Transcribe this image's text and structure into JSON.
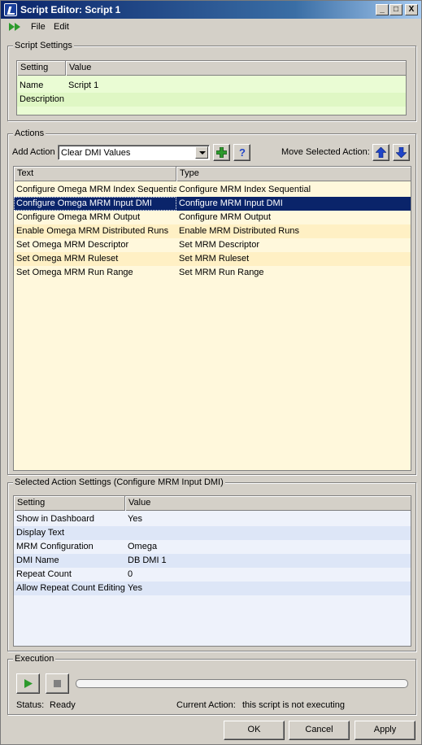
{
  "window": {
    "title": "Script Editor: Script 1",
    "controls": {
      "minimize": "_",
      "maximize": "□",
      "close": "X"
    }
  },
  "menu": {
    "run_icon": "run-forward-icon",
    "items": [
      "File",
      "Edit"
    ]
  },
  "script_settings": {
    "group_label": "Script Settings",
    "columns": [
      "Setting",
      "Value"
    ],
    "rows": [
      {
        "setting": "Name",
        "value": "Script 1"
      },
      {
        "setting": "Description",
        "value": ""
      }
    ]
  },
  "actions": {
    "group_label": "Actions",
    "add_action_label": "Add Action",
    "add_action_value": "Clear DMI Values",
    "add_icon": "add-icon",
    "help_icon": "help-icon",
    "move_label": "Move Selected Action:",
    "move_up_icon": "arrow-up-icon",
    "move_down_icon": "arrow-down-icon",
    "columns": [
      "Text",
      "Type"
    ],
    "rows": [
      {
        "text": "Configure Omega MRM Index Sequential",
        "type": "Configure MRM Index Sequential"
      },
      {
        "text": "Configure Omega MRM Input DMI",
        "type": "Configure MRM Input DMI"
      },
      {
        "text": "Configure Omega MRM Output",
        "type": "Configure MRM Output"
      },
      {
        "text": "Enable Omega MRM Distributed Runs",
        "type": "Enable MRM Distributed Runs"
      },
      {
        "text": "Set Omega MRM Descriptor",
        "type": "Set MRM Descriptor"
      },
      {
        "text": "Set Omega MRM Ruleset",
        "type": "Set MRM Ruleset"
      },
      {
        "text": "Set Omega MRM Run Range",
        "type": "Set MRM Run Range"
      }
    ],
    "selected_index": 1
  },
  "selected_action_settings": {
    "group_label": "Selected Action Settings (Configure MRM Input DMI)",
    "columns": [
      "Setting",
      "Value"
    ],
    "rows": [
      {
        "setting": "Show in Dashboard",
        "value": "Yes"
      },
      {
        "setting": "Display Text",
        "value": ""
      },
      {
        "setting": "MRM Configuration",
        "value": "Omega"
      },
      {
        "setting": "DMI Name",
        "value": "DB DMI 1"
      },
      {
        "setting": "Repeat Count",
        "value": "0"
      },
      {
        "setting": "Allow Repeat Count Editing",
        "value": "Yes"
      }
    ]
  },
  "execution": {
    "group_label": "Execution",
    "play_icon": "play-icon",
    "stop_icon": "stop-icon",
    "progress": 0,
    "status_label": "Status:",
    "status_value": "Ready",
    "current_action_label": "Current Action:",
    "current_action_value": "this script is not executing"
  },
  "buttons": {
    "ok": "OK",
    "cancel": "Cancel",
    "apply": "Apply"
  },
  "colors": {
    "titlebar": "#0a246a",
    "selection": "#0a246a",
    "script_row": "#eafcd4",
    "action_row_a": "#fff8dc",
    "action_row_b": "#fff0c4",
    "settings_row_a": "#eef2fb",
    "settings_row_b": "#dde6f7",
    "icon_green": "#2c9a2c",
    "icon_blue": "#2045c8"
  }
}
